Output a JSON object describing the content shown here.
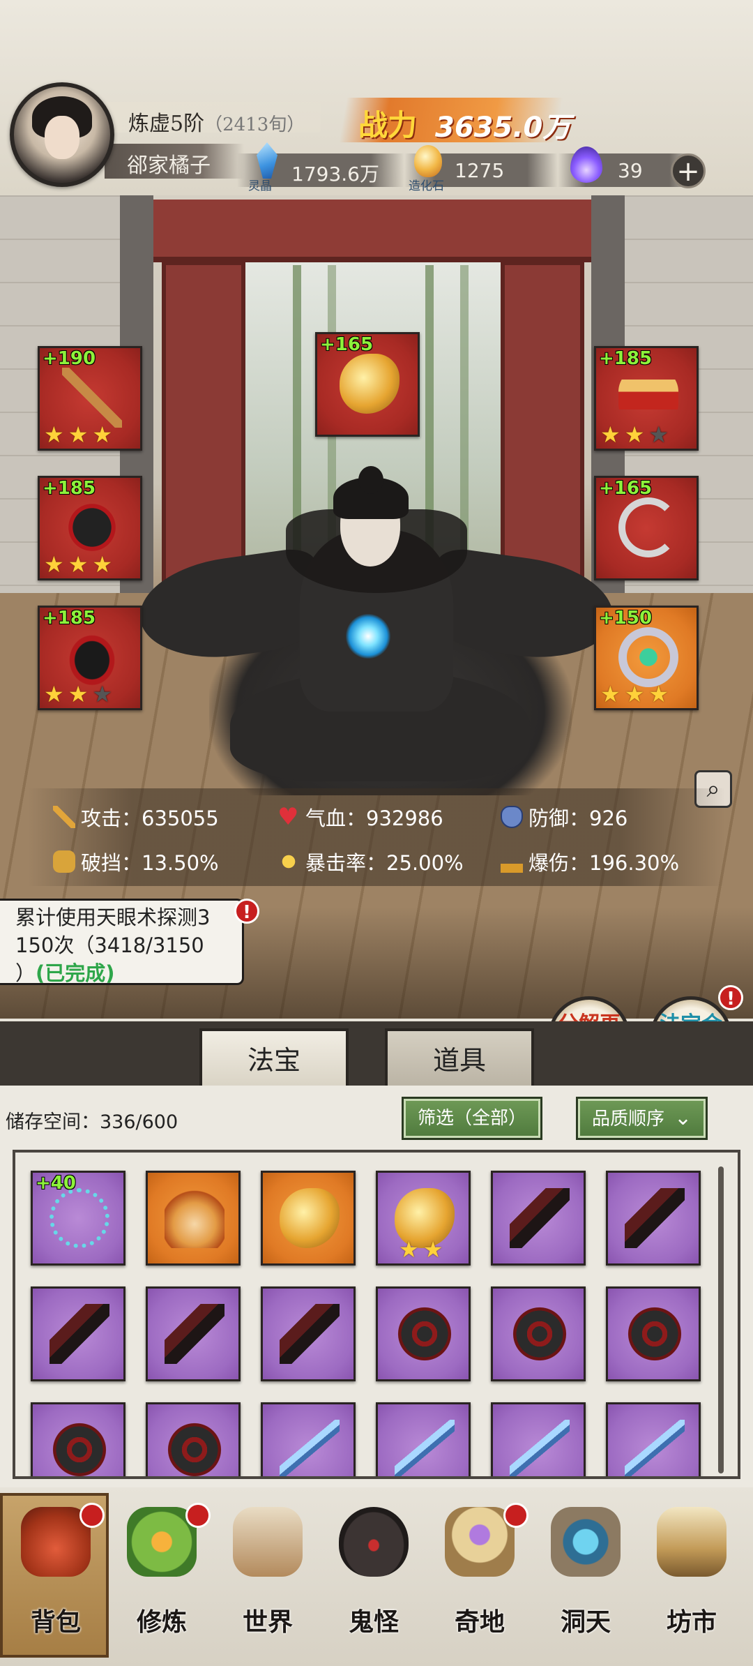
{
  "header": {
    "realm": "炼虚5阶",
    "age": "（2413旬）",
    "user_name": "郤家橘子",
    "power_label": "战力",
    "power_value": "3635.0万",
    "resources": [
      {
        "icon": "spirit-crystal-icon",
        "value": "1793.6万",
        "caption": "灵晶"
      },
      {
        "icon": "creation-stone-icon",
        "value": "1275",
        "caption": "造化石"
      },
      {
        "icon": "purple-flame-icon",
        "value": "39",
        "caption": ""
      }
    ]
  },
  "equipment": {
    "left": [
      {
        "plus": "+190",
        "stars": 3,
        "max_stars": 3,
        "quality": "red",
        "art": "chain-whip"
      },
      {
        "plus": "+185",
        "stars": 3,
        "max_stars": 3,
        "quality": "red",
        "art": "robe"
      },
      {
        "plus": "+185",
        "stars": 2,
        "max_stars": 3,
        "quality": "red",
        "art": "boots"
      }
    ],
    "center": {
      "plus": "+165",
      "quality": "red",
      "art": "golden-cloud"
    },
    "right": [
      {
        "plus": "+185",
        "stars": 2,
        "max_stars": 3,
        "quality": "red",
        "art": "crown"
      },
      {
        "plus": "+165",
        "quality": "red",
        "art": "pendant"
      },
      {
        "plus": "+150",
        "stars": 3,
        "max_stars": 3,
        "quality": "orange",
        "art": "ring"
      }
    ]
  },
  "stats": {
    "attack": "攻击：635055",
    "hp": "气血：932986",
    "defense": "防御：926",
    "break": "破挡：13.50%",
    "crit_rate": "暴击率：25.00%",
    "crit_damage": "爆伤：196.30%"
  },
  "quest": {
    "line1": "累计使用天眼术探测3",
    "line2": "150次（3418/3150",
    "line3_prefix": "）",
    "status": "(已完成)",
    "badge": "!"
  },
  "actions": {
    "decompose": "分解再造",
    "compose": "法宝合成",
    "badge": "!"
  },
  "tabs": [
    {
      "label": "法宝",
      "active": true
    },
    {
      "label": "道具",
      "active": false
    }
  ],
  "inventory": {
    "storage_label": "储存空间：336/600",
    "filter_label": "筛选（全部）",
    "sort_label": "品质顺序",
    "items": [
      {
        "quality": "purple",
        "art": "necklace",
        "plus": "+40",
        "stars": 0
      },
      {
        "quality": "orange",
        "art": "fan",
        "plus": "",
        "stars": 0
      },
      {
        "quality": "orange",
        "art": "golden-cloud",
        "plus": "",
        "stars": 0
      },
      {
        "quality": "purple",
        "art": "golden-cloud",
        "plus": "",
        "stars": 2
      },
      {
        "quality": "purple",
        "art": "dagger",
        "plus": "",
        "stars": 0
      },
      {
        "quality": "purple",
        "art": "dagger",
        "plus": "",
        "stars": 0
      },
      {
        "quality": "purple",
        "art": "dagger",
        "plus": "",
        "stars": 0
      },
      {
        "quality": "purple",
        "art": "dagger",
        "plus": "",
        "stars": 0
      },
      {
        "quality": "purple",
        "art": "dagger",
        "plus": "",
        "stars": 0
      },
      {
        "quality": "purple",
        "art": "wheel",
        "plus": "",
        "stars": 0
      },
      {
        "quality": "purple",
        "art": "wheel",
        "plus": "",
        "stars": 0
      },
      {
        "quality": "purple",
        "art": "wheel",
        "plus": "",
        "stars": 0
      },
      {
        "quality": "purple",
        "art": "wheel",
        "plus": "",
        "stars": 0
      },
      {
        "quality": "purple",
        "art": "wheel",
        "plus": "",
        "stars": 0
      },
      {
        "quality": "purple",
        "art": "sword",
        "plus": "",
        "stars": 0
      },
      {
        "quality": "purple",
        "art": "sword",
        "plus": "",
        "stars": 0
      },
      {
        "quality": "purple",
        "art": "sword",
        "plus": "",
        "stars": 0
      },
      {
        "quality": "purple",
        "art": "sword",
        "plus": "",
        "stars": 0
      }
    ]
  },
  "nav": [
    {
      "label": "背包",
      "icon": "bag-icon",
      "active": true,
      "badge": true
    },
    {
      "label": "修炼",
      "icon": "cultivation-icon",
      "active": false,
      "badge": true
    },
    {
      "label": "世界",
      "icon": "world-scroll-icon",
      "active": false,
      "badge": false
    },
    {
      "label": "鬼怪",
      "icon": "ghost-egg-icon",
      "active": false,
      "badge": false
    },
    {
      "label": "奇地",
      "icon": "wonder-land-icon",
      "active": false,
      "badge": true
    },
    {
      "label": "洞天",
      "icon": "cave-heaven-icon",
      "active": false,
      "badge": false
    },
    {
      "label": "坊市",
      "icon": "market-icon",
      "active": false,
      "badge": false
    }
  ]
}
